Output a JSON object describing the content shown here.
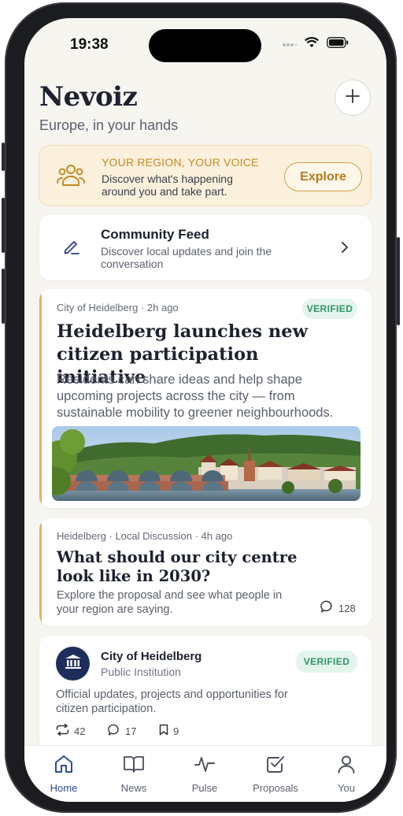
{
  "status_bar": {
    "time": "19:38"
  },
  "header": {
    "title": "Nevoiz",
    "subtitle": "Europe, in your hands",
    "add_icon": "plus-icon"
  },
  "region_banner": {
    "eyebrow": "YOUR REGION, YOUR VOICE",
    "text": "Discover what's happening around you and take part.",
    "button": "Explore",
    "icon": "people-icon"
  },
  "community_feed": {
    "title": "Community Feed",
    "description": "Discover local updates and join the conversation",
    "icon": "pencil-icon"
  },
  "posts": [
    {
      "source": "City of Heidelberg",
      "time": "2h ago",
      "badge": "VERIFIED",
      "headline": "Heidelberg launches new citizen participation initiative",
      "body": "Residents can share ideas and help shape upcoming projects across the city — from sustainable mobility to greener neighbourhoods."
    },
    {
      "source": "Heidelberg",
      "category": "Local Discussion",
      "time": "4h ago",
      "headline": "What should our city centre look like in 2030?",
      "body": "Explore the proposal and see what people in your region are saying.",
      "comments": "128"
    }
  ],
  "institution": {
    "name": "City of Heidelberg",
    "type": "Public Institution",
    "badge": "VERIFIED",
    "description": "Official updates, projects and opportunities for citizen participation.",
    "reposts": "42",
    "comments": "17",
    "saves": "9"
  },
  "tabs": [
    {
      "label": "Home",
      "icon": "home-icon",
      "active": true
    },
    {
      "label": "News",
      "icon": "book-icon"
    },
    {
      "label": "Pulse",
      "icon": "pulse-icon"
    },
    {
      "label": "Proposals",
      "icon": "checkbox-icon"
    },
    {
      "label": "You",
      "icon": "user-icon"
    }
  ],
  "colors": {
    "accent": "#2d4b9e",
    "gold": "#d3a04d",
    "verified": "#2f9466",
    "background": "#f7f5f0"
  }
}
